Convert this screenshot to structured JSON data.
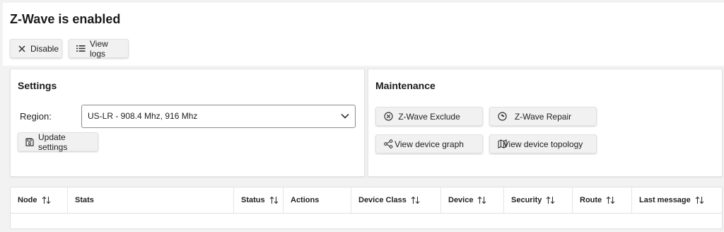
{
  "status": {
    "title": "Z-Wave is enabled",
    "disable_label": "Disable",
    "view_logs_label": "View logs"
  },
  "settings": {
    "title": "Settings",
    "region_label": "Region:",
    "region_value": "US-LR - 908.4 Mhz, 916 Mhz",
    "update_label": "Update settings"
  },
  "maintenance": {
    "title": "Maintenance",
    "exclude_label": "Z-Wave Exclude",
    "repair_label": "Z-Wave Repair",
    "graph_label": "View device graph",
    "topology_label": "View device topology"
  },
  "table": {
    "columns": [
      {
        "label": "Node",
        "sortable": true
      },
      {
        "label": "Stats",
        "sortable": false
      },
      {
        "label": "Status",
        "sortable": true
      },
      {
        "label": "Actions",
        "sortable": false
      },
      {
        "label": "Device Class",
        "sortable": true
      },
      {
        "label": "Device",
        "sortable": true
      },
      {
        "label": "Security",
        "sortable": true
      },
      {
        "label": "Route",
        "sortable": true
      },
      {
        "label": "Last message",
        "sortable": true
      }
    ]
  },
  "icons": {
    "disable": "close-icon",
    "view_logs": "list-icon",
    "update": "save-icon",
    "exclude": "circle-x-icon",
    "repair": "repair-icon",
    "graph": "share-graph-icon",
    "topology": "map-icon",
    "select": "chevron-down-icon",
    "sort": "sort-arrows-icon"
  }
}
